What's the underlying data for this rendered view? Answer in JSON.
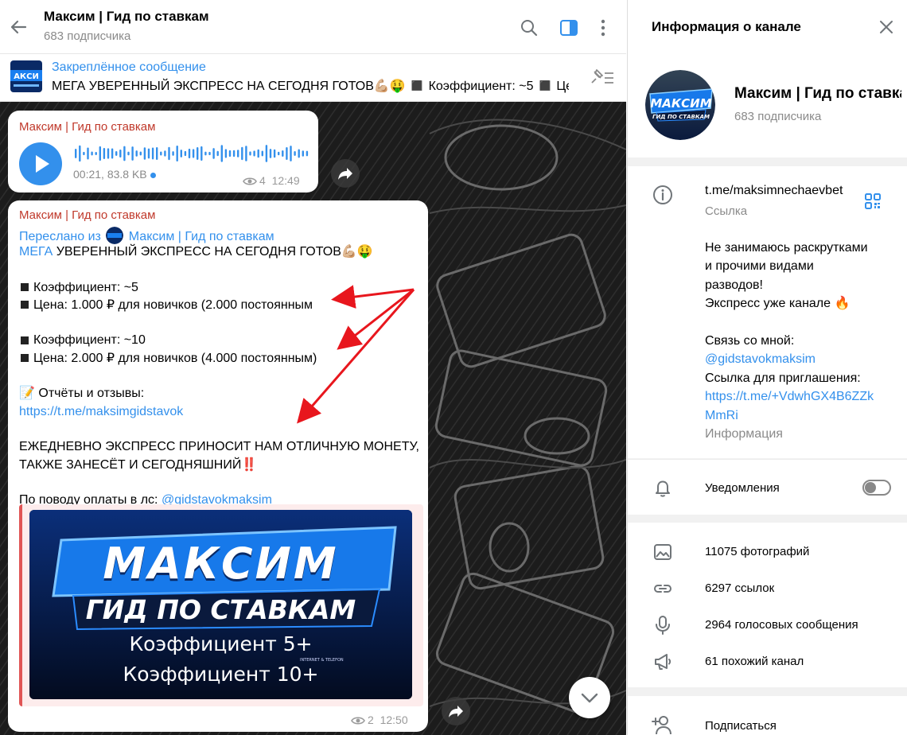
{
  "chat": {
    "title": "Максим | Гид по ставкам",
    "subtitle": "683 подписчика",
    "icons": [
      "back-arrow-icon",
      "search-icon",
      "sidebar-toggle-icon",
      "more-vertical-icon"
    ],
    "pinned": {
      "title": "Закреплённое сообщение",
      "text": "МЕГА УВЕРЕННЫЙ ЭКСПРЕСС НА СЕГОДНЯ ГОТОВ💪🏼🤑   ◼️ Коэффициент: ~5   ◼️ Це..."
    },
    "voice_message": {
      "sender": "Максим | Гид по ставкам",
      "meta": "00:21, 83.8 KB",
      "views": "4",
      "time": "12:49"
    },
    "post": {
      "sender": "Максим | Гид по ставкам",
      "forwarded_prefix": "Переслано из",
      "forwarded_from": "Максим | Гид по ставкам",
      "line_1_link": "МЕГА",
      "line_1_rest": " УВЕРЕННЫЙ ЭКСПРЕСС НА СЕГОДНЯ ГОТОВ💪🏼🤑",
      "line_2": "Коэффициент: ~5",
      "line_3": "Цена: 1.000 ₽ для новичков (2.000 постоянным",
      "line_4": "Коэффициент: ~10",
      "line_5": "Цена: 2.000 ₽ для новичков (4.000 постоянным)",
      "line_6": "📝 Отчёты и отзывы:",
      "line_7_link": "https://t.me/maksimgidstavok",
      "line_8": "ЕЖЕДНЕВНО ЭКСПРЕСС ПРИНОСИТ НАМ ОТЛИЧНУЮ МОНЕТУ,",
      "line_9": "ТАКЖЕ ЗАНЕСЁТ И СЕГОДНЯШНИЙ‼️",
      "line_10_prefix": "По поводу оплаты в лс: ",
      "line_10_link": "@gidstavokmaksim",
      "preview": {
        "title_1": "МАКСИМ",
        "title_2": "ГИД ПО СТАВКАМ",
        "line_1": "Коэффициент 5+",
        "line_2": "Коэффициент 10+",
        "small_1": "INTERNET & TELEFON"
      },
      "views": "2",
      "time": "12:50"
    }
  },
  "info_panel": {
    "header": "Информация о канале",
    "avatar_text": "МАКСИМ",
    "avatar_sub": "ГИД ПО СТАВКАМ",
    "channel_name": "Максим | Гид по ставкам",
    "channel_sub": "683 подписчика",
    "link": "t.me/maksimnechaevbet",
    "link_label": "Ссылка",
    "description": [
      "Не занимаюсь раскрутками",
      "и прочими видами",
      "разводов!",
      "Экспресс уже канале 🔥",
      "",
      "Связь со мной:"
    ],
    "contact_link": "@gidstavokmaksim",
    "invite_label": "Ссылка для приглашения:",
    "invite_link_1": "https://t.me/+VdwhGX4B6ZZk",
    "invite_link_2": "MmRi",
    "info_label": "Информация",
    "notifications_label": "Уведомления",
    "notifications_on": false,
    "media": [
      {
        "label": "11075 фотографий",
        "icon": "photo-icon"
      },
      {
        "label": "6297 ссылок",
        "icon": "link-icon"
      },
      {
        "label": "2964 голосовых сообщения",
        "icon": "microphone-icon"
      },
      {
        "label": "61 похожий канал",
        "icon": "megaphone-icon"
      }
    ],
    "subscribe_label": "Подписаться"
  },
  "colors": {
    "accent": "#3390ec",
    "sender": "#c0392b",
    "annotation_arrows": "#e8161d",
    "preview_border": "#e05555"
  }
}
